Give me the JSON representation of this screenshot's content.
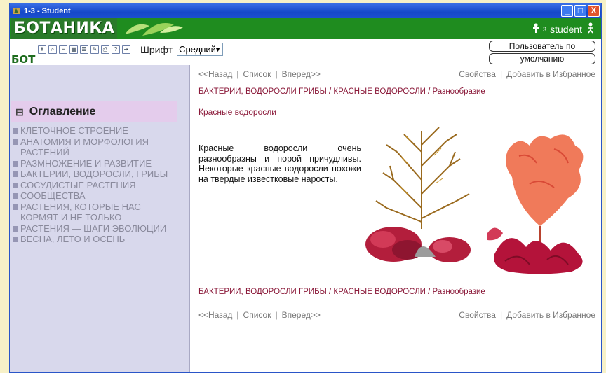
{
  "window": {
    "title": "1-3 - Student",
    "controls": {
      "minimize": "_",
      "maximize": "□",
      "close": "X"
    }
  },
  "banner": {
    "brand": "БОТАНИКА",
    "user_label": "student",
    "user_sup": "3"
  },
  "toolbar": {
    "brand_fragment": "БОТ",
    "font_label": "Шрифт",
    "font_value": "Средний",
    "user_line1": "Пользователь по",
    "user_line2": "умолчанию"
  },
  "sidebar": {
    "header": "Оглавление",
    "items": [
      "КЛЕТОЧНОЕ СТРОЕНИЕ",
      "АНАТОМИЯ И МОРФОЛОГИЯ РАСТЕНИЙ",
      "РАЗМНОЖЕНИЕ И РАЗВИТИЕ",
      "БАКТЕРИИ, ВОДОРОСЛИ, ГРИБЫ",
      "СОСУДИСТЫЕ РАСТЕНИЯ",
      "СООБЩЕСТВА",
      "РАСТЕНИЯ, КОТОРЫЕ НАС КОРМЯТ И НЕ ТОЛЬКО",
      "РАСТЕНИЯ — ШАГИ ЭВОЛЮЦИИ",
      "ВЕСНА, ЛЕТО И ОСЕНЬ"
    ]
  },
  "nav": {
    "back": "<<Назад",
    "list": "Список",
    "forward": "Вперед>>",
    "properties": "Свойства",
    "add_favorites": "Добавить в Избранное",
    "sep": "|"
  },
  "content": {
    "breadcrumb": "БАКТЕРИИ, ВОДОРОСЛИ ГРИБЫ / КРАСНЫЕ ВОДОРОСЛИ / Разнообразие",
    "subtitle": "Красные водоросли",
    "description": "Красные водоросли очень разнообразны и порой причудливы. Некоторые красные водоросли похожи на твердые известковые наросты."
  },
  "colors": {
    "title_bar": "#1548c9",
    "banner_green": "#1f8c1f",
    "sidebar_bg": "#d8d8ec",
    "toc_header_bg": "#e4ccec",
    "link_red": "#8b1a3a",
    "page_bg": "#f7f1c8"
  }
}
